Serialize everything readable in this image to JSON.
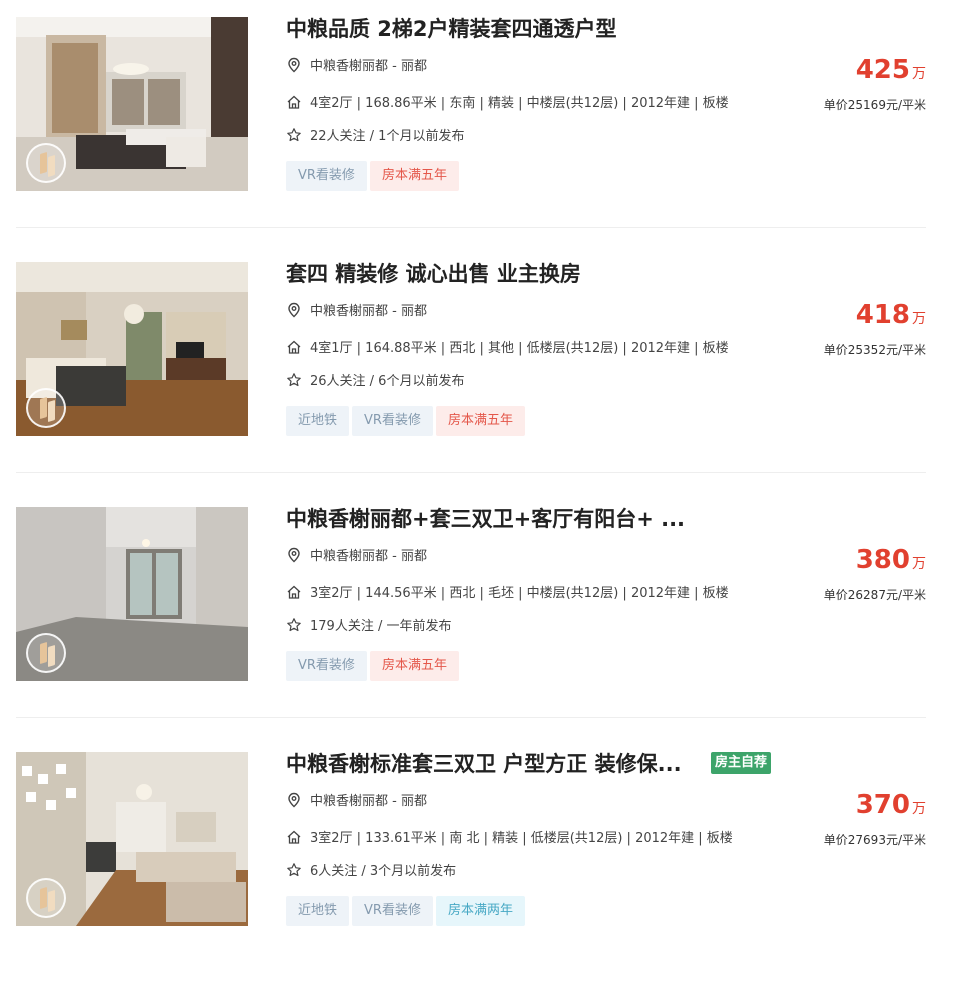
{
  "listings": [
    {
      "title": "中粮品质 2梯2户精装套四通透户型",
      "address": "中粮香榭丽都 - 丽都",
      "house_info": "4室2厅 | 168.86平米 | 东南 | 精装 | 中楼层(共12层) | 2012年建 | 板楼",
      "follow_info": "22人关注 / 1个月以前发布",
      "tags": [
        {
          "text": "VR看装修",
          "style": "blue"
        },
        {
          "text": "房本满五年",
          "style": "red"
        }
      ],
      "total_price": "425",
      "price_unit": "万",
      "unit_price": "单价25169元/平米"
    },
    {
      "title": "套四 精装修 诚心出售 业主换房",
      "address": "中粮香榭丽都 - 丽都",
      "house_info": "4室1厅 | 164.88平米 | 西北 | 其他 | 低楼层(共12层) | 2012年建 | 板楼",
      "follow_info": "26人关注 / 6个月以前发布",
      "tags": [
        {
          "text": "近地铁",
          "style": "blue"
        },
        {
          "text": "VR看装修",
          "style": "blue"
        },
        {
          "text": "房本满五年",
          "style": "red"
        }
      ],
      "total_price": "418",
      "price_unit": "万",
      "unit_price": "单价25352元/平米"
    },
    {
      "title": "中粮香榭丽都+套三双卫+客厅有阳台+ ...",
      "address": "中粮香榭丽都 - 丽都",
      "house_info": "3室2厅 | 144.56平米 | 西北 | 毛坯 | 中楼层(共12层) | 2012年建 | 板楼",
      "follow_info": "179人关注 / 一年前发布",
      "tags": [
        {
          "text": "VR看装修",
          "style": "blue"
        },
        {
          "text": "房本满五年",
          "style": "red"
        }
      ],
      "total_price": "380",
      "price_unit": "万",
      "unit_price": "单价26287元/平米"
    },
    {
      "title": "中粮香榭标准套三双卫 户型方正 装修保...",
      "owner_tag": "房主自荐",
      "address": "中粮香榭丽都 - 丽都",
      "house_info": "3室2厅 | 133.61平米 | 南 北 | 精装 | 低楼层(共12层) | 2012年建 | 板楼",
      "follow_info": "6人关注 / 3个月以前发布",
      "tags": [
        {
          "text": "近地铁",
          "style": "blue"
        },
        {
          "text": "VR看装修",
          "style": "blue"
        },
        {
          "text": "房本满两年",
          "style": "cyan"
        }
      ],
      "total_price": "370",
      "price_unit": "万",
      "unit_price": "单价27693元/平米"
    }
  ],
  "colors": {
    "price": "#e1402f",
    "tag_blue_bg": "#eef3f8",
    "tag_red_bg": "#fdecea",
    "tag_cyan_bg": "#e6f6fb",
    "owner_tag_bg": "#3da46a"
  },
  "icons": {
    "address": "location-pin-icon",
    "house": "house-icon",
    "follow": "star-icon",
    "vr": "vr-badge-icon"
  }
}
